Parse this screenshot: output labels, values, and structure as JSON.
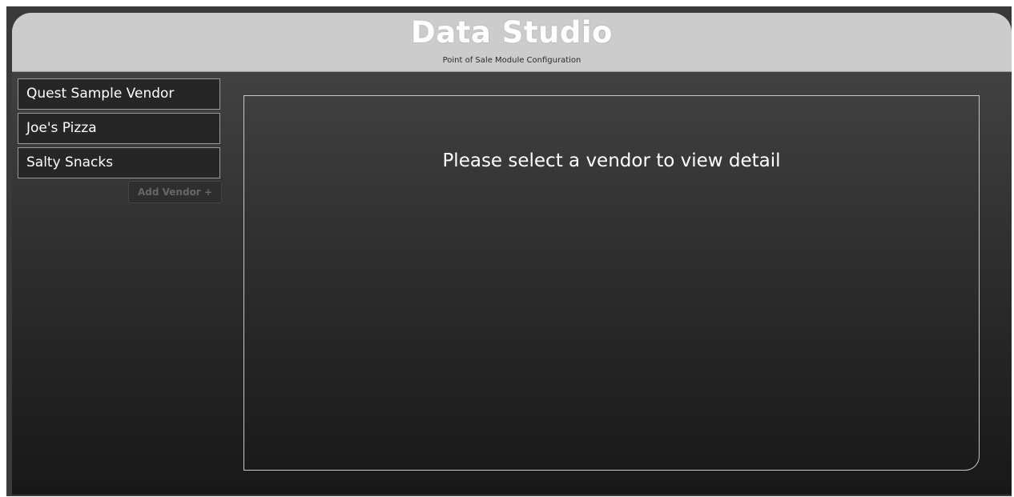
{
  "header": {
    "title": "Data Studio",
    "subtitle": "Point of Sale Module Configuration"
  },
  "sidebar": {
    "vendors": [
      {
        "label": "Quest Sample Vendor"
      },
      {
        "label": "Joe's Pizza"
      },
      {
        "label": "Salty Snacks"
      }
    ],
    "add_vendor_label": "Add Vendor +"
  },
  "main": {
    "empty_message": "Please select a vendor to view detail"
  },
  "colors": {
    "header_bg": "#cccccc",
    "app_bg_top": "#484848",
    "app_bg_bottom": "#181818",
    "text_light": "#ffffff"
  }
}
